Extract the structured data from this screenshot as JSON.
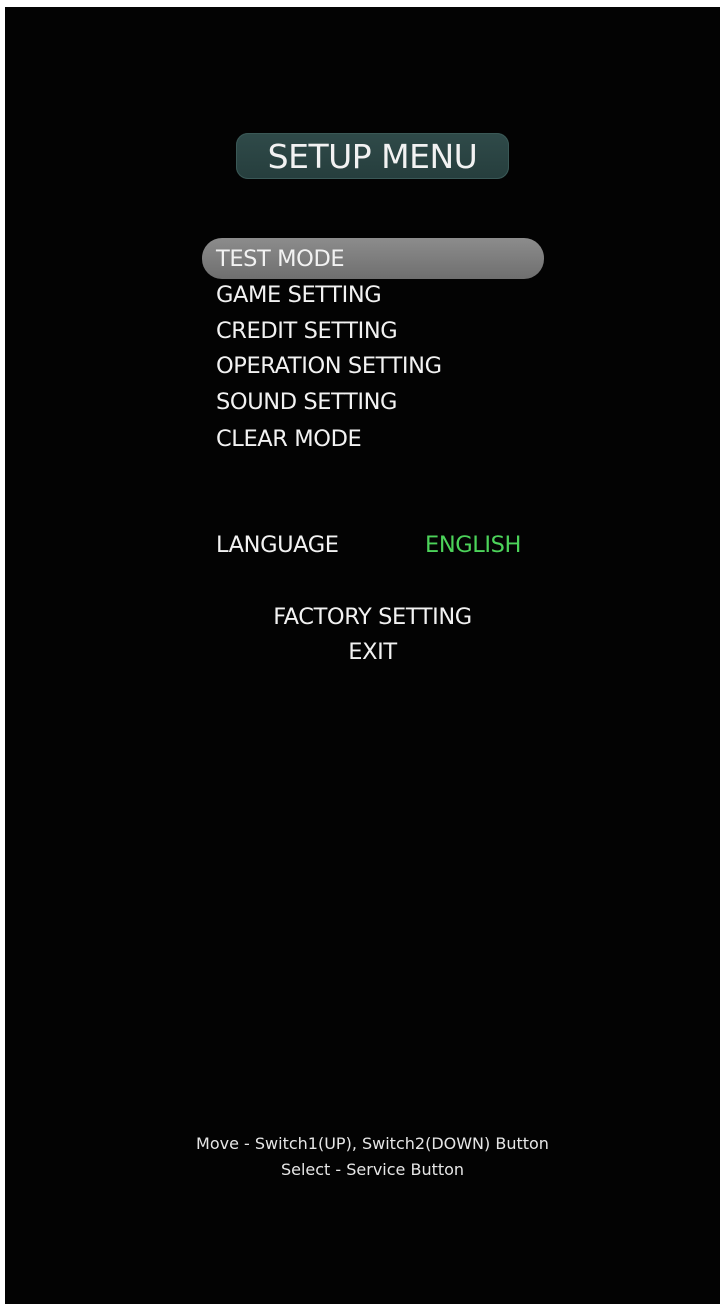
{
  "title": "SETUP MENU",
  "menu": {
    "selected_index": 0,
    "items": [
      {
        "label": "TEST MODE"
      },
      {
        "label": "GAME SETTING"
      },
      {
        "label": "CREDIT SETTING"
      },
      {
        "label": "OPERATION SETTING"
      },
      {
        "label": "SOUND SETTING"
      },
      {
        "label": "CLEAR MODE"
      }
    ]
  },
  "language": {
    "label": "LANGUAGE",
    "value": "ENGLISH"
  },
  "actions": {
    "factory_setting": "FACTORY SETTING",
    "exit": "EXIT"
  },
  "help": {
    "move": "Move - Switch1(UP), Switch2(DOWN) Button",
    "select": "Select - Service Button"
  },
  "colors": {
    "background": "#030303",
    "text": "#f2f2f2",
    "highlight": "#7d7d7d",
    "title_box": "#2b4443",
    "language_value": "#4cd35a"
  }
}
